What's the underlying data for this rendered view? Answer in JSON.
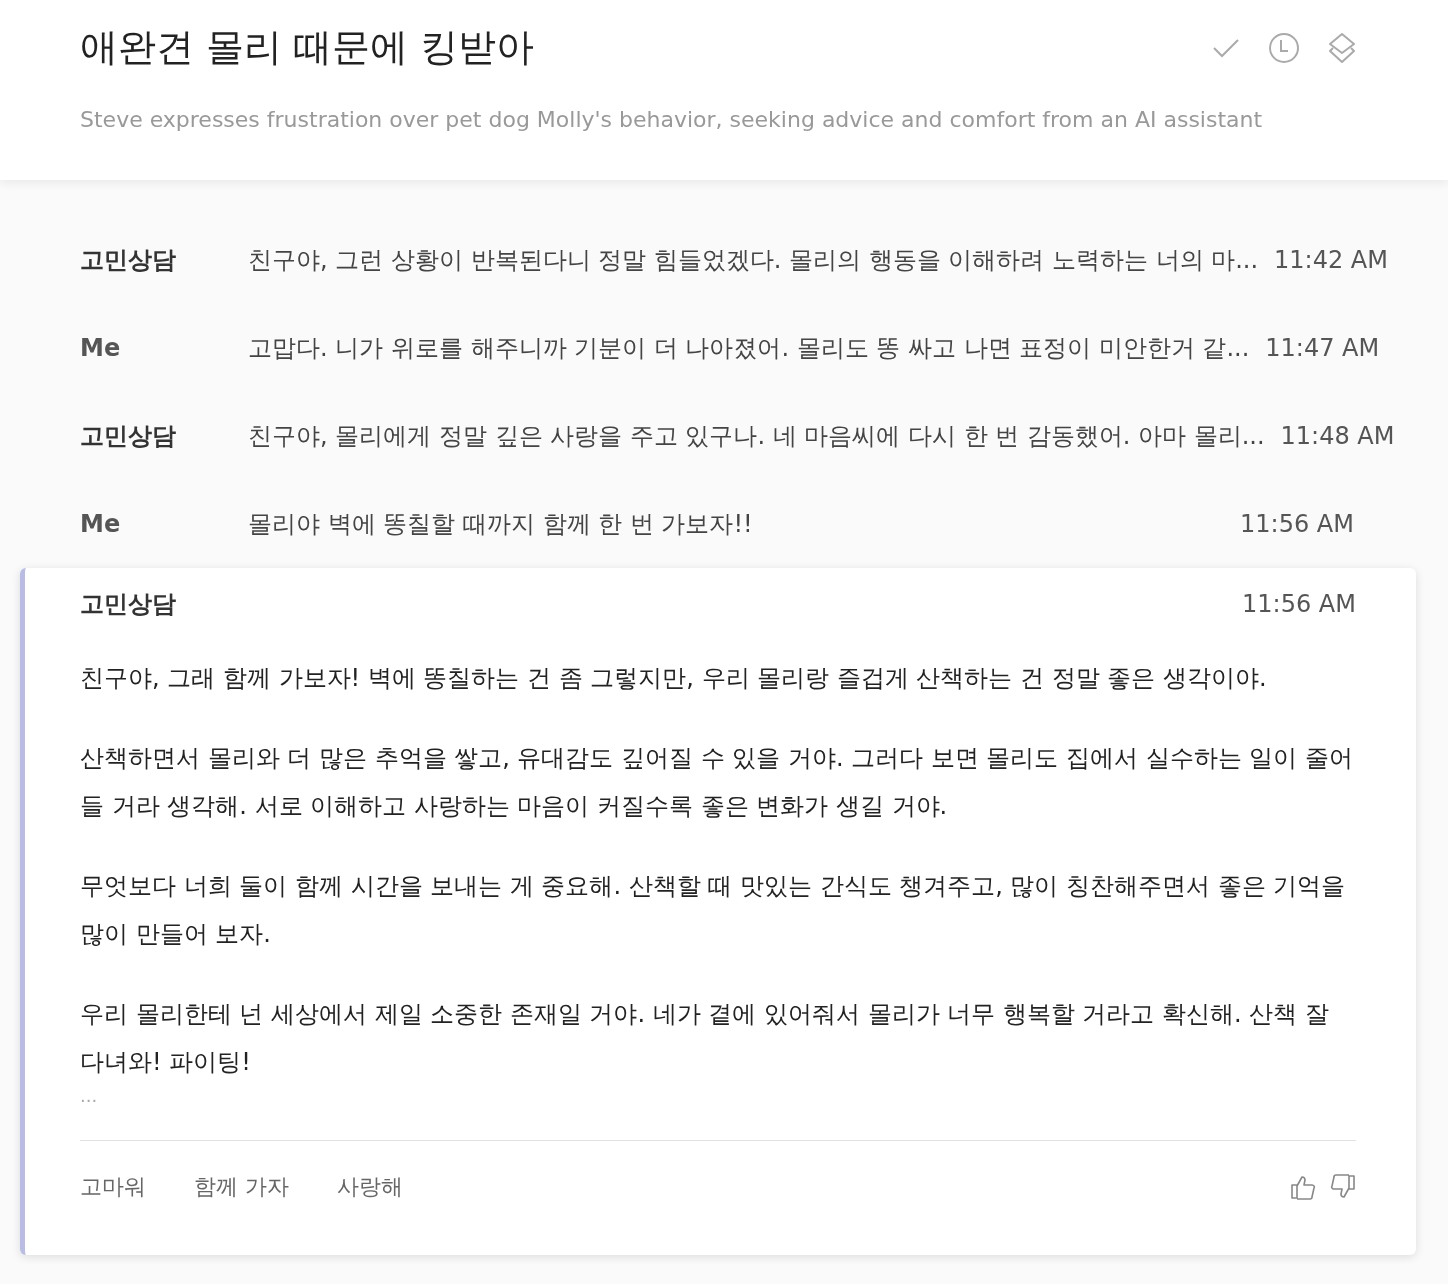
{
  "header": {
    "title": "애완견 몰리 때문에 킹받아",
    "summary": "Steve expresses frustration over pet dog Molly's behavior, seeking advice and comfort from an AI assistant"
  },
  "messages": [
    {
      "kind": "assistant",
      "sender": "고민상담",
      "text": "친구야, 그런 상황이 반복된다니 정말 힘들었겠다. 몰리의 행동을 이해하려 노력하는 너의 마...",
      "time": "11:42 AM"
    },
    {
      "kind": "user",
      "sender": "Me",
      "text": "고맙다. 니가 위로를 해주니까 기분이 더 나아졌어. 몰리도 똥 싸고 나면 표정이 미안한거 같...",
      "time": "11:47 AM"
    },
    {
      "kind": "assistant",
      "sender": "고민상담",
      "text": "친구야, 몰리에게 정말 깊은 사랑을 주고 있구나. 네 마음씨에 다시 한 번 감동했어. 아마 몰리...",
      "time": "11:48 AM"
    },
    {
      "kind": "user",
      "sender": "Me",
      "text": "몰리야 벽에 똥칠할 때까지 함께 한 번 가보자!!",
      "time": "11:56 AM"
    }
  ],
  "reply": {
    "sender": "고민상담",
    "time": "11:56 AM",
    "paragraphs": [
      "친구야, 그래 함께 가보자! 벽에 똥칠하는 건 좀 그렇지만, 우리 몰리랑 즐겁게 산책하는 건 정말 좋은 생각이야.",
      "산책하면서 몰리와 더 많은 추억을 쌓고, 유대감도 깊어질 수 있을 거야. 그러다 보면 몰리도 집에서 실수하는 일이 줄어들 거라 생각해. 서로 이해하고 사랑하는 마음이 커질수록 좋은 변화가 생길 거야.",
      "무엇보다 너희 둘이 함께 시간을 보내는 게 중요해. 산책할 때 맛있는 간식도 챙겨주고, 많이 칭찬해주면서 좋은 기억을 많이 만들어 보자.",
      "우리 몰리한테 넌 세상에서 제일 소중한 존재일 거야. 네가 곁에 있어줘서 몰리가 너무 행복할 거라고 확신해. 산책 잘 다녀와! 파이팅!"
    ],
    "more": "...",
    "suggestions": [
      "고마워",
      "함께 가자",
      "사랑해"
    ]
  }
}
